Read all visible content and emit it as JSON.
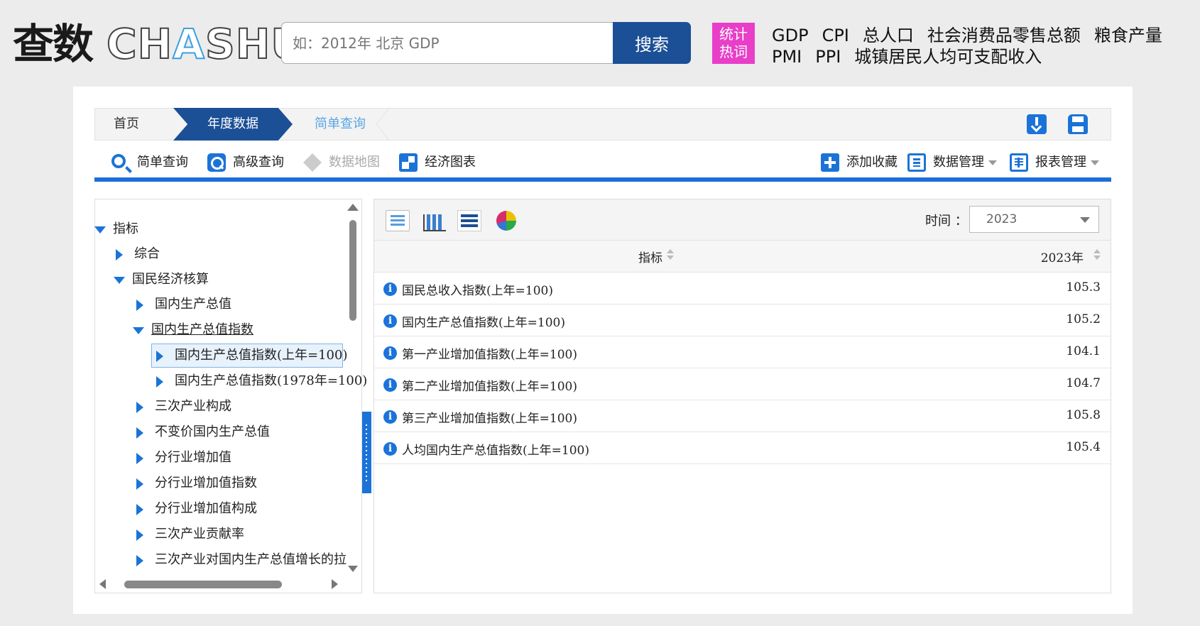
{
  "header": {
    "logo_cn": "查数",
    "logo_en_pre": "CH",
    "logo_en_hl": "A",
    "logo_en_post": "SHU",
    "search_placeholder": "如：2012年 北京 GDP",
    "search_button": "搜索",
    "hot_badge_line1": "统计",
    "hot_badge_line2": "热词",
    "hot_words_row1": [
      "GDP",
      "CPI",
      "总人口",
      "社会消费品零售总额",
      "粮食产量"
    ],
    "hot_words_row2": [
      "PMI",
      "PPI",
      "城镇居民人均可支配收入"
    ]
  },
  "breadcrumb": {
    "home": "首页",
    "active": "年度数据",
    "current": "简单查询"
  },
  "toolbar": {
    "simple_query": "简单查询",
    "advanced_query": "高级查询",
    "data_map": "数据地图",
    "econ_chart": "经济图表",
    "add_favorite": "添加收藏",
    "data_manage": "数据管理",
    "report_manage": "报表管理"
  },
  "tree": {
    "root": "指标",
    "items": [
      "综合",
      "国民经济核算",
      "国内生产总值",
      "国内生产总值指数",
      "国内生产总值指数(上年=100)",
      "国内生产总值指数(1978年=100)",
      "三次产业构成",
      "不变价国内生产总值",
      "分行业增加值",
      "分行业增加值指数",
      "分行业增加值构成",
      "三次产业贡献率",
      "三次产业对国内生产总值增长的拉动"
    ]
  },
  "table": {
    "time_label": "时间 ：",
    "time_value": "2023",
    "col_indicator": "指标",
    "col_year": "2023年",
    "rows": [
      {
        "name": "国民总收入指数(上年=100)",
        "value": "105.3"
      },
      {
        "name": "国内生产总值指数(上年=100)",
        "value": "105.2"
      },
      {
        "name": "第一产业增加值指数(上年=100)",
        "value": "104.1"
      },
      {
        "name": "第二产业增加值指数(上年=100)",
        "value": "104.7"
      },
      {
        "name": "第三产业增加值指数(上年=100)",
        "value": "105.8"
      },
      {
        "name": "人均国内生产总值指数(上年=100)",
        "value": "105.4"
      }
    ]
  }
}
